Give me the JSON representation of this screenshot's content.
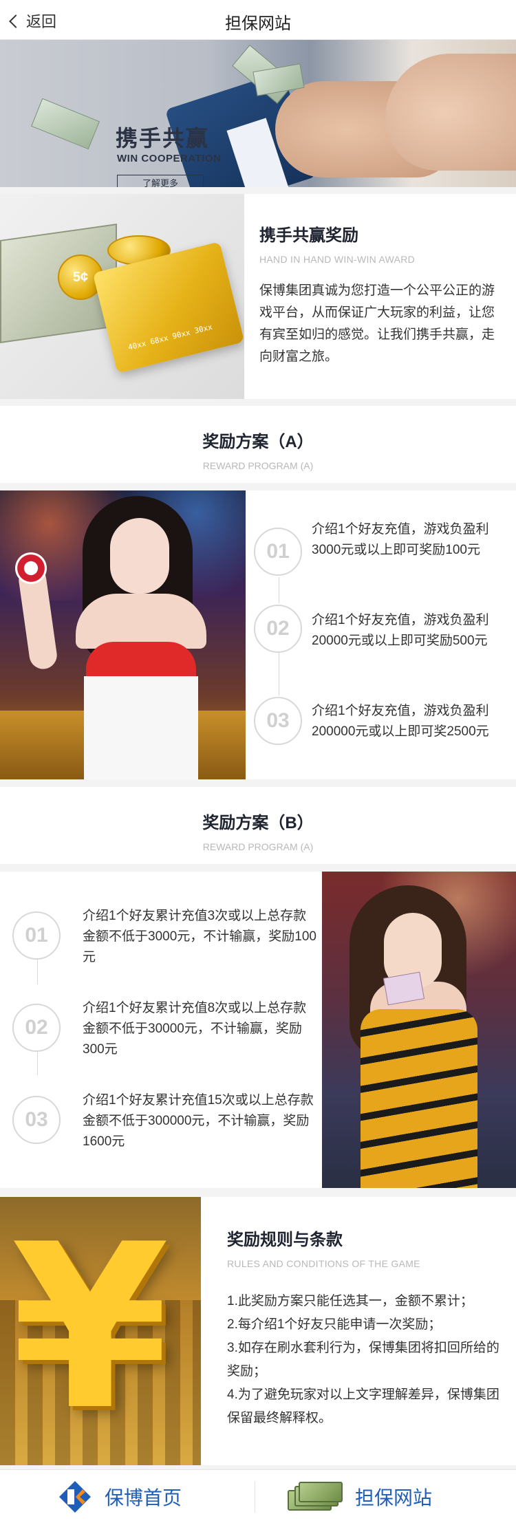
{
  "header": {
    "back_label": "返回",
    "title": "担保网站"
  },
  "banner": {
    "title": "携手共赢",
    "subtitle": "WIN COOPERATION",
    "button_label": "了解更多"
  },
  "award": {
    "title": "携手共赢奖励",
    "subtitle": "HAND IN HAND WIN-WIN AWARD",
    "body": "保博集团真诚为您打造一个公平公正的游戏平台，从而保证广大玩家的利益，让您有宾至如归的感觉。让我们携手共赢，走向财富之旅。",
    "coin_text": "5¢",
    "card_text": "40xx 68xx 90xx 30xx"
  },
  "program_a": {
    "title": "奖励方案（A）",
    "subtitle": "REWARD PROGRAM (A)",
    "steps": [
      {
        "num": "01",
        "text": "介绍1个好友充值，游戏负盈利3000元或以上即可奖励100元"
      },
      {
        "num": "02",
        "text": "介绍1个好友充值，游戏负盈利20000元或以上即可奖励500元"
      },
      {
        "num": "03",
        "text": "介绍1个好友充值，游戏负盈利200000元或以上即可奖2500元"
      }
    ]
  },
  "program_b": {
    "title": "奖励方案（B）",
    "subtitle": "REWARD PROGRAM (A)",
    "steps": [
      {
        "num": "01",
        "text": "介绍1个好友累计充值3次或以上总存款金额不低于3000元，不计输赢，奖励100元"
      },
      {
        "num": "02",
        "text": "介绍1个好友累计充值8次或以上总存款金额不低于30000元，不计输赢，奖励300元"
      },
      {
        "num": "03",
        "text": "介绍1个好友累计充值15次或以上总存款金额不低于300000元，不计输赢，奖励1600元"
      }
    ]
  },
  "rules": {
    "title": "奖励规则与条款",
    "subtitle": "RULES AND CONDITIONS OF THE GAME",
    "yen_symbol": "¥",
    "items": [
      "1.此奖励方案只能任选其一，金额不累计；",
      "2.每介绍1个好友只能申请一次奖励；",
      "3.如存在刷水套利行为，保博集团将扣回所给的奖励；",
      "4.为了避免玩家对以上文字理解差异，保博集团保留最终解释权。"
    ]
  },
  "bottom_nav": {
    "home_label": "保博首页",
    "guarantee_label": "担保网站"
  },
  "colors": {
    "accent_blue": "#1f5db8",
    "title_dark": "#1f2430",
    "muted": "#b8b8b8"
  }
}
